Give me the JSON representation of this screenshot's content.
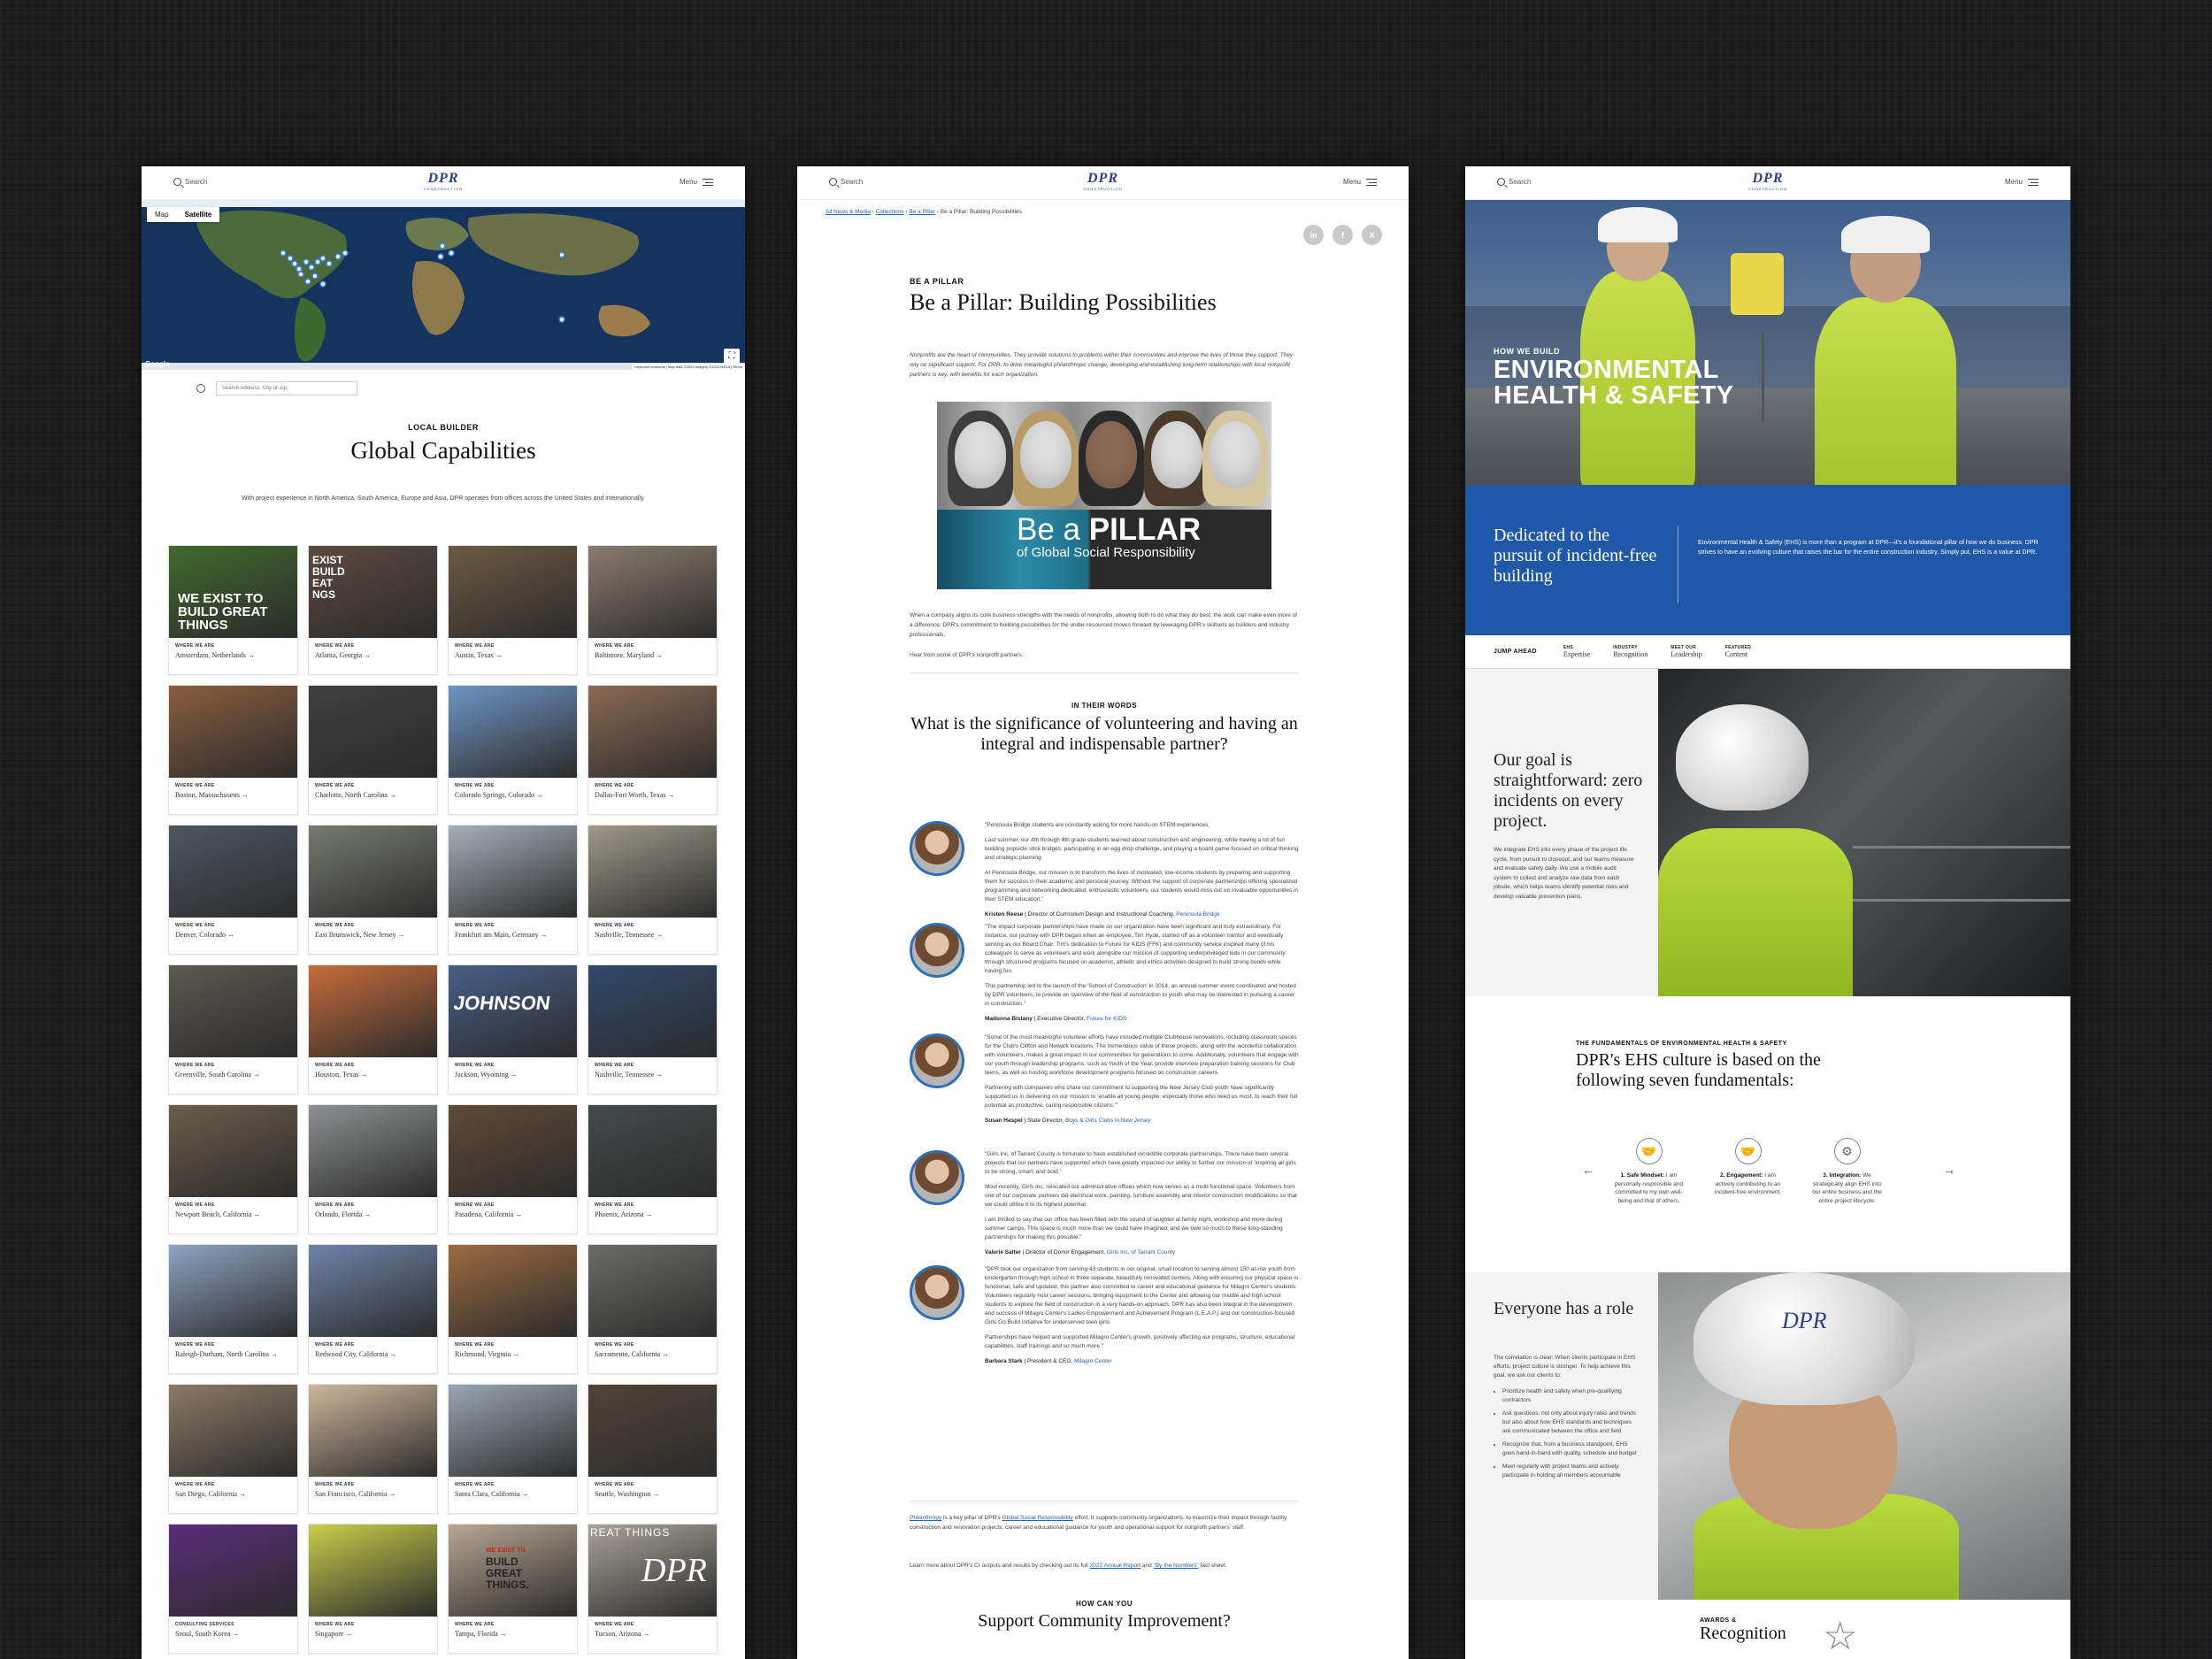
{
  "header": {
    "search_label": "Search",
    "logo_text": "DPR",
    "logo_sub": "CONSTRUCTION",
    "menu_label": "Menu"
  },
  "panel1": {
    "map": {
      "toggle_map": "Map",
      "toggle_satellite": "Satellite",
      "google": "Google",
      "credit": "Keyboard shortcuts | Map data ©2023 Imagery ©2023 NASA | Terms"
    },
    "search_placeholder": "Search Address, City or Zip",
    "eyebrow": "LOCAL BUILDER",
    "title": "Global Capabilities",
    "description": "With project experience in North America, South America, Europe and Asia, DPR operates from offices across the United States and internationally.",
    "cards": [
      {
        "kicker": "WHERE WE ARE",
        "city": "Amsterdam, Netherlands",
        "bg": "#3f6b2c"
      },
      {
        "kicker": "WHERE WE ARE",
        "city": "Atlanta, Georgia",
        "bg": "#5b4a3f"
      },
      {
        "kicker": "WHERE WE ARE",
        "city": "Austin, Texas",
        "bg": "#6b5a42"
      },
      {
        "kicker": "WHERE WE ARE",
        "city": "Baltimore, Maryland",
        "bg": "#8a7c6d"
      },
      {
        "kicker": "WHERE WE ARE",
        "city": "Boston, Massachusetts",
        "bg": "#8a5e3e"
      },
      {
        "kicker": "WHERE WE ARE",
        "city": "Charlotte, North Carolina",
        "bg": "#3f3f3f"
      },
      {
        "kicker": "WHERE WE ARE",
        "city": "Colorado Springs, Colorado",
        "bg": "#6e95c4"
      },
      {
        "kicker": "WHERE WE ARE",
        "city": "Dallas-Fort Worth, Texas",
        "bg": "#8b6a52"
      },
      {
        "kicker": "WHERE WE ARE",
        "city": "Denver, Colorado",
        "bg": "#4e5660"
      },
      {
        "kicker": "WHERE WE ARE",
        "city": "East Brunswick, New Jersey",
        "bg": "#777a72"
      },
      {
        "kicker": "WHERE WE ARE",
        "city": "Frankfurt am Main, Germany",
        "bg": "#a7b0b8"
      },
      {
        "kicker": "WHERE WE ARE",
        "city": "Nashville, Tennessee",
        "bg": "#9e9a8a"
      },
      {
        "kicker": "WHERE WE ARE",
        "city": "Greenville, South Carolina",
        "bg": "#5c5852"
      },
      {
        "kicker": "WHERE WE ARE",
        "city": "Houston, Texas",
        "bg": "#c76c3a"
      },
      {
        "kicker": "WHERE WE ARE",
        "city": "Jackson, Wyoming",
        "bg": "#465f86"
      },
      {
        "kicker": "WHERE WE ARE",
        "city": "Nashville, Tennessee",
        "bg": "#2f4a6b"
      },
      {
        "kicker": "WHERE WE ARE",
        "city": "Newport Beach, California",
        "bg": "#6a5d4a"
      },
      {
        "kicker": "WHERE WE ARE",
        "city": "Orlando, Florida",
        "bg": "#8e9091"
      },
      {
        "kicker": "WHERE WE ARE",
        "city": "Pasadena, California",
        "bg": "#5f4a35"
      },
      {
        "kicker": "WHERE WE ARE",
        "city": "Phoenix, Arizona",
        "bg": "#454a4a"
      },
      {
        "kicker": "WHERE WE ARE",
        "city": "Raleigh-Durham, North Carolina",
        "bg": "#8da4c2"
      },
      {
        "kicker": "WHERE WE ARE",
        "city": "Redwood City, California",
        "bg": "#6e84a8"
      },
      {
        "kicker": "WHERE WE ARE",
        "city": "Richmond, Virginia",
        "bg": "#9c6b40"
      },
      {
        "kicker": "WHERE WE ARE",
        "city": "Sacramento, California",
        "bg": "#6b6b68"
      },
      {
        "kicker": "WHERE WE ARE",
        "city": "San Diego, California",
        "bg": "#8a7b66"
      },
      {
        "kicker": "WHERE WE ARE",
        "city": "San Francisco, California",
        "bg": "#cdb79a"
      },
      {
        "kicker": "WHERE WE ARE",
        "city": "Santa Clara, California",
        "bg": "#9aa6b1"
      },
      {
        "kicker": "WHERE WE ARE",
        "city": "Seattle, Washington",
        "bg": "#4f4338"
      },
      {
        "kicker": "CONSULTING SERVICES",
        "city": "Seoul, South Korea",
        "bg": "#5b2c7a"
      },
      {
        "kicker": "WHERE WE ARE",
        "city": "Singapore",
        "bg": "#c7d04a"
      },
      {
        "kicker": "WHERE WE ARE",
        "city": "Tampa, Florida",
        "bg": "#b8a892"
      },
      {
        "kicker": "WHERE WE ARE",
        "city": "Tucson, Arizona",
        "bg": "#a8a39a"
      }
    ],
    "card_overlays": {
      "amsterdam": "WE EXIST TO BUILD GREAT THINGS",
      "atlanta": "EXIST BUILD EAT NGS",
      "jackson": "JOHNSON",
      "tampa": "BUILD GREAT THINGS.",
      "tampa_small": "WE EXIST TO",
      "tucson": "REAT THINGS",
      "tucson_logo": "DPR"
    }
  },
  "panel2": {
    "breadcrumb": {
      "c1": "All News & Media",
      "c2": "Collections",
      "c3": "Be a Pillar",
      "current": "Be a Pillar: Building Possibilities",
      "sep": "›"
    },
    "social": {
      "linkedin": "in",
      "facebook": "f",
      "x": "X"
    },
    "eyebrow": "BE A PILLAR",
    "title": "Be a Pillar: Building Possibilities",
    "lead": "Nonprofits are the heart of communities. They provide solutions to problems within their communities and improve the lives of those they support. They rely on significant support. For DPR, to drive meaningful philanthropic change, developing and establishing long-term relationships with local nonprofit partners is key, with benefits for each organization.",
    "hero": {
      "t1a": "Be a ",
      "t1b": "PILLAR",
      "t2": "of Global Social Responsibility"
    },
    "p1": "When a company aligns its core business strengths with the needs of nonprofits, allowing both to do what they do best, the work can make even more of a difference. DPR's commitment to building possibilities for the under-resourced moves forward by leveraging DPR's skillsets as builders and industry professionals.",
    "p2": "Hear from some of DPR's nonprofit partners.",
    "iw_eyebrow": "IN THEIR WORDS",
    "iw_title": "What is the significance of volunteering and having an integral and indispensable partner?",
    "quotes": [
      {
        "paras": [
          "\"Peninsula Bridge students are constantly asking for more hands-on STEM experiences.",
          "Last summer, our 4th through 8th grade students learned about construction and engineering, while having a lot of fun building popsicle stick bridges, participating in an egg drop challenge, and playing a board game focused on critical thinking and strategic planning.",
          "At Peninsula Bridge, our mission is to transform the lives of motivated, low-income students by preparing and supporting them for success in their academic and personal journey. Without the support of corporate partnerships offering specialized programming and networking dedicated, enthusiastic volunteers, our students would miss out on invaluable opportunities in their STEM education.\""
        ],
        "name": "Kristen Reese",
        "role": " | Director of Curriculum Design and Instructional Coaching, ",
        "org": "Peninsula Bridge"
      },
      {
        "paras": [
          "\"The impact corporate partnerships have made on our organization have been significant and truly extraordinary. For instance, our journey with DPR began when an employee, Tim Hyde, started off as a volunteer mentor and eventually serving as our Board Chair. Tim's dedication to Future for KIDS (FFK) and community service inspired many of his colleagues to serve as volunteers and work alongside our mission of supporting underprivileged kids in our community through structured programs focused on academic, athletic and ethics activities designed to build strong bonds while having fun.",
          "This partnership led to the launch of the 'School of Construction' in 2014, an annual summer event coordinated and hosted by DPR volunteers, to provide an overview of the field of construction to youth who may be interested in pursuing a career in construction.\""
        ],
        "name": "Madonna Bistany",
        "role": " | Executive Director, ",
        "org": "Future for KIDS"
      },
      {
        "paras": [
          "\"Some of the most meaningful volunteer efforts have included multiple Clubhouse renovations, including classroom spaces for the Club's Clifton and Newark locations. The tremendous value of these projects, along with the wonderful collaboration with volunteers, makes a great impact in our communities for generations to come. Additionally, volunteers that engage with our youth through leadership programs, such as Youth of the Year, provide interview preparation training sessions for Club teens, as well as hosting workforce development programs focused on construction careers.",
          "Partnering with companies who share our commitment to supporting the New Jersey Club youth have significantly supported us in delivering on our mission to 'enable all young people, especially those who need us most, to reach their full potential as productive, caring responsible citizens.'\""
        ],
        "name": "Susan Haspel",
        "role": " | State Director, ",
        "org": "Boys & Girls Clubs in New Jersey"
      },
      {
        "paras": [
          "\"Girls Inc. of Tarrant County is fortunate to have established incredible corporate partnerships. There have been several projects that our partners have supported which have greatly impacted our ability to further our mission of 'inspiring all girls to be strong, smart, and bold.'",
          "Most recently, Girls Inc. relocated our administrative offices which now serves as a multi-functional space. Volunteers from one of our corporate partners did electrical work, painting, furniture assembly and interior construction modifications so that we could utilize it to its highest potential.",
          "I am thrilled to say that our office has been filled with the sound of laughter at family night, workshop and more during summer camps. This space is much more than we could have imagined, and we owe so much to these long-standing partnerships for making this possible.\""
        ],
        "name": "Valerie Salter",
        "role": " | Director of Donor Engagement, ",
        "org": "Girls Inc. of Tarrant County"
      },
      {
        "paras": [
          "\"DPR took our organization from serving 43 students in our original, small location to serving almost 150 at-risk youth from kindergarten through high school in three separate, beautifully renovated centers. Along with ensuring our physical space is functional, safe and updated, this partner also committed to career and educational guidance for Milagro Center's students. Volunteers regularly host career sessions, bringing equipment to the Center and allowing our middle and high school students to explore the field of construction in a very hands-on approach. DPR has also been integral in the development and success of Milagro Center's Ladies Empowerment and Achievement Program (L.E.A.P.) and our construction-focused Girls Go Build initiative for underserved teen girls.",
          "Partnerships have helped and supported Milagro Center's growth, positively affecting our programs, structure, educational capabilities, staff trainings and so much more.\""
        ],
        "name": "Barbara Stark",
        "role": " | President & CEO, ",
        "org": "Milagro Center"
      }
    ],
    "closing_link1": "Philanthropy",
    "closing_text1": " is a key pillar of DPR's ",
    "closing_link2": "Global Social Responsibility",
    "closing_text2": " effort. It supports community organizations, to maximize their impact through facility construction and renovation projects, career and educational guidance for youth and operational support for nonprofit partners' staff.",
    "closing_text3": "Learn more about DPR's CI outputs and results by checking out its full ",
    "closing_link3": "2022 Annual Report",
    "closing_text4": " and ",
    "closing_link4": "\"By the Numbers\"",
    "closing_text5": " fact sheet.",
    "cta_eyebrow": "HOW CAN YOU",
    "cta_title": "Support Community Improvement?"
  },
  "panel3": {
    "hero_eyebrow": "HOW WE BUILD",
    "hero_title": "ENVIRONMENTAL HEALTH & SAFETY",
    "dedicated": "Dedicated to the pursuit of incident-free building",
    "dedicated_para": "Environmental Health & Safety (EHS) is more than a program at DPR—it's a foundational pillar of how we do business. DPR strives to have an evolving culture that raises the bar for the entire construction industry. Simply put, EHS is a value at DPR.",
    "jump_label": "JUMP AHEAD",
    "jump_items": [
      {
        "small": "EHS",
        "main": "Expertise"
      },
      {
        "small": "INDUSTRY",
        "main": "Recognition"
      },
      {
        "small": "MEET OUR",
        "main": "Leadership"
      },
      {
        "small": "FEATURED",
        "main": "Content"
      }
    ],
    "goal_title": "Our goal is straightforward: zero incidents on every project.",
    "goal_para": "We integrate EHS into every phase of the project life cycle, from pursuit to closeout, and our teams measure and evaluate safety daily. We use a mobile audit system to collect and analyze raw data from each jobsite, which helps teams identify potential risks and develop valuable prevention plans.",
    "fund_eyebrow": "THE FUNDAMENTALS OF ENVIRONMENTAL HEALTH & SAFETY",
    "fund_title": "DPR's EHS culture is based on the following seven fundamentals:",
    "fundamentals": [
      {
        "title": "1. Safe Mindset:",
        "text": " I am personally responsible and committed to my own well-being and that of others."
      },
      {
        "title": "2. Engagement:",
        "text": " I am actively contributing to an incident-free environment."
      },
      {
        "title": "3. Integration:",
        "text": " We strategically align EHS into our entire business and the entire project lifecycle."
      }
    ],
    "role_title": "Everyone has a role",
    "role_para": "The correlation is clear: When clients participate in EHS efforts, project culture is stronger. To help achieve this goal, we ask our clients to:",
    "role_list": [
      "Prioritize health and safety when pre-qualifying contractors",
      "Ask questions, not only about injury rates and trends but also about how EHS standards and techniques are communicated between the office and field",
      "Recognize that, from a business standpoint, EHS goes hand-in-hand with quality, schedule and budget",
      "Meet regularly with project teams and actively participate in holding all members accountable"
    ],
    "awards_eyebrow": "AWARDS &",
    "awards_title": "Recognition",
    "helmet_logo": "DPR"
  }
}
